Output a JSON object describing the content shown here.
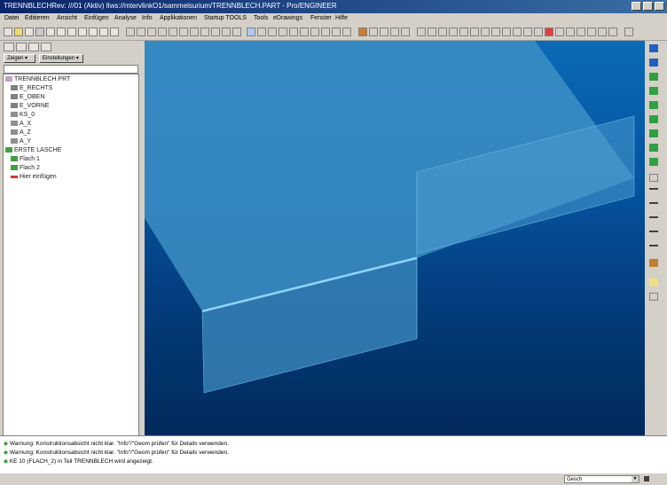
{
  "titlebar": {
    "title": "TRENNBLECHRev: ///01 (Aktiv) Ilws://mtervlinkO1/sammelsurium/TRENNBLECH.PART - Pro/ENGINEER"
  },
  "menubar": {
    "items": [
      "Datei",
      "Editieren",
      "Ansicht",
      "Einfügen",
      "Analyse",
      "Info",
      "Applikationen",
      "Startup TOOLS",
      "Tools",
      "eDrawings",
      "Fenster",
      "Hilfe"
    ]
  },
  "left_panel": {
    "show_button": "Zeigen ▾",
    "settings_button": "Einstellungen ▾",
    "tree": [
      "TRENNBLECH.PRT",
      "E_RECHTS",
      "E_OBEN",
      "E_VORNE",
      "KS_0",
      "A_X",
      "A_Z",
      "A_Y",
      "ERSTE LASCHE",
      "Flach 1",
      "Flach 2",
      "Hier einfügen"
    ]
  },
  "messages": [
    "Warnung: Konstruktionsabsicht nicht klar. \"Info\"/\"Geom prüfen\" für Details verwenden.",
    "Warnung: Konstruktionsabsicht nicht klar. \"Info\"/\"Geom prüfen\" für Details verwenden.",
    "KE 10 (FLACH_2) in Teil TRENNBLECH wird angezeigt."
  ],
  "status": {
    "filter_value": "Gesch"
  },
  "colors": {
    "title_bar": "#0a246a",
    "viewport_top": "#0a6ab6",
    "viewport_bottom": "#022a5c",
    "sheet": "#3d8fc4"
  }
}
